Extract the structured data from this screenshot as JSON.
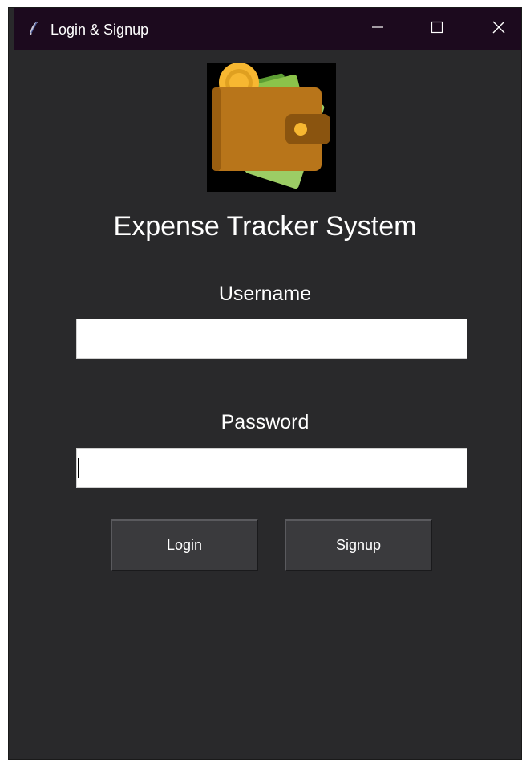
{
  "window": {
    "title": "Login & Signup",
    "icon": "feather-icon",
    "controls": [
      "minimize-icon",
      "maximize-icon",
      "close-icon"
    ]
  },
  "app": {
    "logo_icon": "wallet-icon",
    "title": "Expense Tracker System"
  },
  "form": {
    "username_label": "Username",
    "username_value": "",
    "password_label": "Password",
    "password_value": ""
  },
  "buttons": {
    "login_label": "Login",
    "signup_label": "Signup"
  },
  "colors": {
    "background": "#29292b",
    "titlebar": "#1c0a1e",
    "button": "#3a3a3d",
    "text": "#ffffff"
  }
}
